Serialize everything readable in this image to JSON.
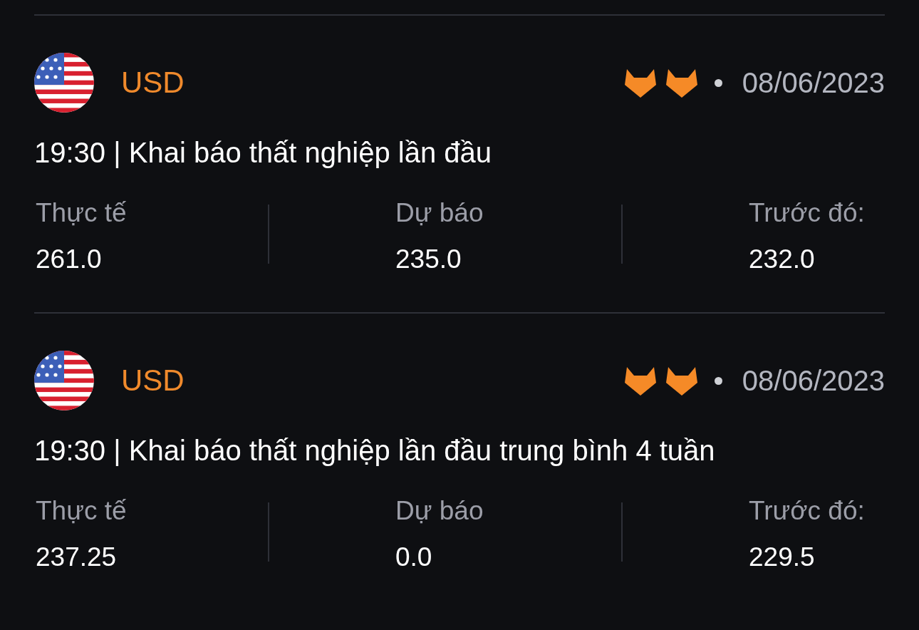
{
  "events": [
    {
      "currency": "USD",
      "stars": 2,
      "date": "08/06/2023",
      "time": "19:30",
      "separator": "|",
      "title": "Khai báo thất nghiệp lần đầu",
      "stats": [
        {
          "label": "Thực tế",
          "value": "261.0"
        },
        {
          "label": "Dự báo",
          "value": "235.0"
        },
        {
          "label": "Trước đó:",
          "value": "232.0"
        }
      ]
    },
    {
      "currency": "USD",
      "stars": 2,
      "date": "08/06/2023",
      "time": "19:30",
      "separator": "|",
      "title": "Khai báo thất nghiệp lần đầu trung bình 4 tuần",
      "stats": [
        {
          "label": "Thực tế",
          "value": "237.25"
        },
        {
          "label": "Dự báo",
          "value": "0.0"
        },
        {
          "label": "Trước đó:",
          "value": "229.5"
        }
      ]
    }
  ]
}
